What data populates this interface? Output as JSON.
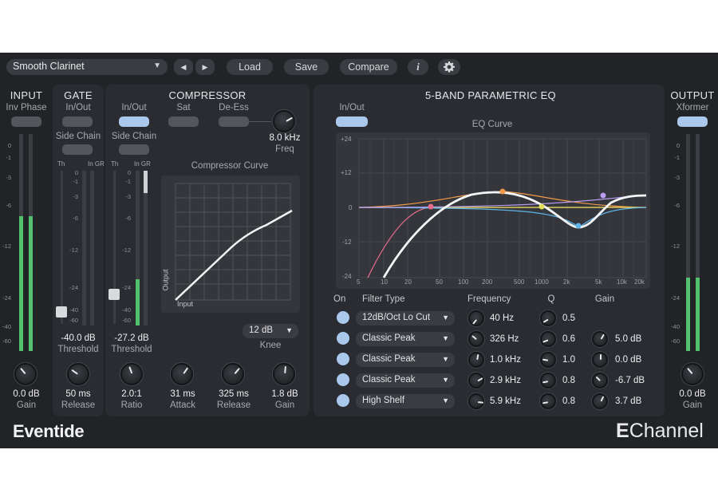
{
  "toolbar": {
    "preset": "Smooth Clarinet",
    "prev_glyph": "◀",
    "next_glyph": "▶",
    "load": "Load",
    "save": "Save",
    "compare": "Compare",
    "info_glyph": "i",
    "settings_icon": "gear-icon"
  },
  "input": {
    "title": "INPUT",
    "inv_phase": "Inv Phase",
    "scale": [
      "0",
      "-1",
      "-3",
      "-6",
      "-12",
      "-24",
      "-40",
      "-60"
    ],
    "level_left": 0.62,
    "level_right": 0.62,
    "gain_value": "0.0 dB",
    "gain_label": "Gain"
  },
  "gate": {
    "title": "GATE",
    "in_out": "In/Out",
    "side_chain": "Side Chain",
    "th": "Th",
    "in_gr": "In GR",
    "scale": [
      "0",
      "-1",
      "-3",
      "-6",
      "-12",
      "-24",
      "-40",
      "-60"
    ],
    "threshold_value": "-40.0 dB",
    "threshold_label": "Threshold",
    "release_value": "50 ms",
    "release_label": "Release"
  },
  "compressor": {
    "title": "COMPRESSOR",
    "in_out": "In/Out",
    "sat": "Sat",
    "de_ess": "De-Ess",
    "freq_value": "8.0 kHz",
    "freq_label": "Freq",
    "side_chain": "Side Chain",
    "th": "Th",
    "in_gr": "In GR",
    "scale": [
      "0",
      "-1",
      "-3",
      "-6",
      "-12",
      "-24",
      "-40",
      "-60"
    ],
    "curve_title": "Compressor Curve",
    "curve_x_label": "Input",
    "curve_y_label": "Output",
    "threshold_value": "-27.2 dB",
    "threshold_label": "Threshold",
    "knee_value": "12 dB",
    "knee_label": "Knee",
    "knobs": [
      {
        "value": "2.0:1",
        "label": "Ratio"
      },
      {
        "value": "31 ms",
        "label": "Attack"
      },
      {
        "value": "325 ms",
        "label": "Release"
      },
      {
        "value": "1.8 dB",
        "label": "Gain"
      }
    ]
  },
  "eq": {
    "title": "5-BAND PARAMETRIC EQ",
    "in_out": "In/Out",
    "curve_title": "EQ Curve",
    "y_ticks": [
      "+24",
      "+12",
      "0",
      "-12",
      "-24"
    ],
    "x_ticks": [
      "5",
      "10",
      "20",
      "50",
      "100",
      "200",
      "500",
      "1000",
      "2k",
      "5k",
      "10k",
      "20k"
    ],
    "headers": {
      "on": "On",
      "filter_type": "Filter Type",
      "frequency": "Frequency",
      "q": "Q",
      "gain": "Gain"
    },
    "bands": [
      {
        "type": "12dB/Oct Lo Cut",
        "freq": "40 Hz",
        "q": "0.5",
        "gain": "",
        "color": "#e86c8c"
      },
      {
        "type": "Classic Peak",
        "freq": "326 Hz",
        "q": "0.6",
        "gain": "5.0 dB",
        "color": "#f09a4a"
      },
      {
        "type": "Classic Peak",
        "freq": "1.0 kHz",
        "q": "1.0",
        "gain": "0.0 dB",
        "color": "#e2e05a"
      },
      {
        "type": "Classic Peak",
        "freq": "2.9 kHz",
        "q": "0.8",
        "gain": "-6.7 dB",
        "color": "#5fb4e8"
      },
      {
        "type": "High Shelf",
        "freq": "5.9 kHz",
        "q": "0.8",
        "gain": "3.7 dB",
        "color": "#b99cf0"
      }
    ]
  },
  "output": {
    "title": "OUTPUT",
    "xformer": "Xformer",
    "scale": [
      "0",
      "-1",
      "-3",
      "-6",
      "-12",
      "-24",
      "-40",
      "-60"
    ],
    "level_left": 0.34,
    "level_right": 0.34,
    "gain_value": "0.0 dB",
    "gain_label": "Gain"
  },
  "brand": {
    "logo": "Eventide",
    "product_bold": "E",
    "product_rest": "Channel"
  },
  "colors": {
    "accent": "#a9c8ec",
    "meter": "#52c26f",
    "background": "#222327",
    "panel": "#2b2c31"
  }
}
